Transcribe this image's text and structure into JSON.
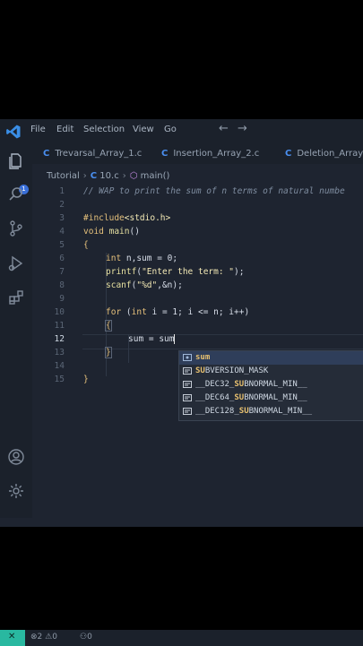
{
  "menu": [
    "File",
    "Edit",
    "Selection",
    "View",
    "Go"
  ],
  "activity": {
    "badge_count": "1"
  },
  "tabs": [
    {
      "label": "Trevarsal_Array_1.c"
    },
    {
      "label": "Insertion_Array_2.c"
    },
    {
      "label": "Deletion_Array_"
    }
  ],
  "breadcrumb": {
    "root": "Tutorial",
    "file": "10.c",
    "symbol": "main()"
  },
  "editor": {
    "current_line": "12",
    "line_numbers": [
      "1",
      "2",
      "3",
      "4",
      "5",
      "6",
      "7",
      "8",
      "9",
      "10",
      "11",
      "12",
      "13",
      "14",
      "15"
    ],
    "lines": {
      "l1": "// WAP to print the sum of n terms of natural numbe",
      "l4_a": "#include",
      "l4_b": "<stdio.h>",
      "l5_a": "void ",
      "l5_b": "main",
      "l5_c": "()",
      "l6": "{",
      "l7_a": "int ",
      "l7_b": "n,sum = 0;",
      "l8_a": "printf",
      "l8_b": "(",
      "l8_c": "\"Enter the term: \"",
      "l8_d": ");",
      "l9_a": "scanf",
      "l9_b": "(",
      "l9_c": "\"%d\"",
      "l9_d": ",&n);",
      "l11_a": "for ",
      "l11_b": "(",
      "l11_c": "int ",
      "l11_d": "i = 1; i <= n; i++)",
      "l12": "{",
      "l13": "sum = sum",
      "l14": "}",
      "l16": "}"
    }
  },
  "suggestions": [
    {
      "pre": "",
      "hl": "sum",
      "post": "",
      "kind": "variable-icon"
    },
    {
      "pre": "",
      "hl": "SU",
      "post": "BVERSION_MASK",
      "kind": "keyword-icon"
    },
    {
      "pre": "__DEC32_",
      "hl": "SU",
      "post": "BNORMAL_MIN__",
      "kind": "keyword-icon"
    },
    {
      "pre": "__DEC64_",
      "hl": "SU",
      "post": "BNORMAL_MIN__",
      "kind": "keyword-icon"
    },
    {
      "pre": "__DEC128_",
      "hl": "SU",
      "post": "BNORMAL_MIN__",
      "kind": "keyword-icon"
    }
  ],
  "status": {
    "errors": "2",
    "warnings": "0",
    "ports": "0"
  },
  "colors": {
    "accent": "#29b8a0",
    "keyword": "#e5c07b",
    "cfile": "#4a8ff0",
    "badge": "#3a6fd8"
  }
}
